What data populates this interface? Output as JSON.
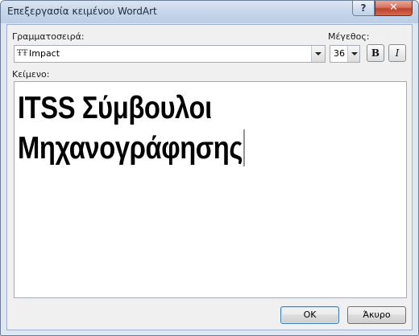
{
  "window": {
    "title": "Επεξεργασία κειμένου WordArt",
    "help_label": "?",
    "close_label": "✕"
  },
  "font": {
    "label": "Γραμματοσειρά:",
    "value": "Impact",
    "icon": "truetype-font-icon"
  },
  "size": {
    "label": "Μέγεθος:",
    "value": "36"
  },
  "format": {
    "bold_label": "B",
    "italic_label": "I"
  },
  "text": {
    "label": "Κείμενο:",
    "line1": "ITSS Σύμβουλοι",
    "line2": "Μηχανογράφησης"
  },
  "buttons": {
    "ok": "OK",
    "cancel": "Άκυρο"
  }
}
